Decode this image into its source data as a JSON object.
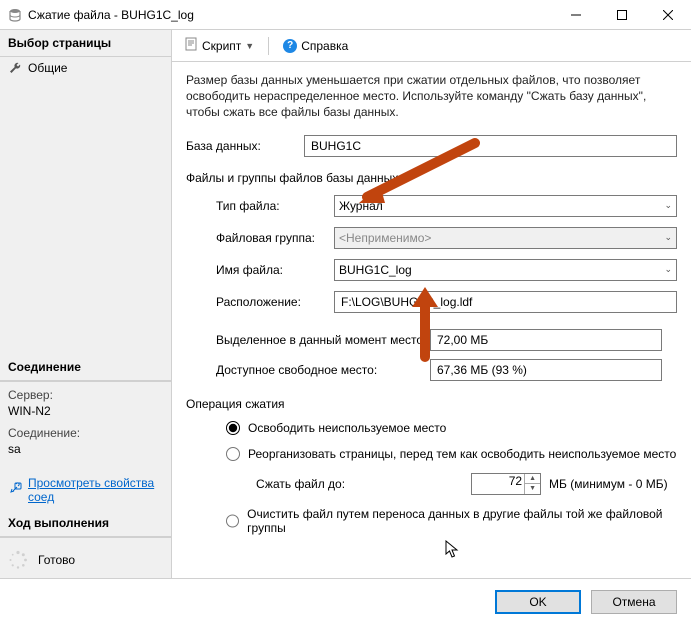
{
  "window": {
    "title": "Сжатие файла - BUHG1C_log"
  },
  "sidebar": {
    "page_select": "Выбор страницы",
    "page_general": "Общие",
    "connection_header": "Соединение",
    "server_label": "Сервер:",
    "server_value": "WIN-N2",
    "conn_label": "Соединение:",
    "conn_value": "sa",
    "view_props": "Просмотреть свойства соед",
    "progress_header": "Ход выполнения",
    "progress_status": "Готово"
  },
  "toolbar": {
    "script": "Скрипт",
    "help": "Справка"
  },
  "content": {
    "description": "Размер базы данных уменьшается при сжатии отдельных файлов, что позволяет освободить нераспределенное место. Используйте команду \"Сжать базу данных\", чтобы сжать все файлы базы данных.",
    "db_label": "База данных:",
    "db_value": "BUHG1C",
    "files_section": "Файлы и группы файлов базы данных",
    "file_type_label": "Тип файла:",
    "file_type_value": "Журнал",
    "filegroup_label": "Файловая группа:",
    "filegroup_value": "<Неприменимо>",
    "filename_label": "Имя файла:",
    "filename_value": "BUHG1C_log",
    "location_label": "Расположение:",
    "location_value": "F:\\LOG\\BUHG1C_log.ldf",
    "allocated_label": "Выделенное в данный момент место:",
    "allocated_value": "72,00 МБ",
    "available_label": "Доступное свободное место:",
    "available_value": "67,36 МБ (93 %)",
    "op_label": "Операция сжатия",
    "op_release": "Освободить неиспользуемое место",
    "op_reorganize": "Реорганизовать страницы, перед тем как освободить неиспользуемое место",
    "shrink_to_label": "Сжать файл до:",
    "shrink_to_value": "72",
    "shrink_to_units": "МБ (минимум - 0 МБ)",
    "op_empty": "Очистить файл путем переноса данных в другие файлы той же файловой группы"
  },
  "footer": {
    "ok": "OK",
    "cancel": "Отмена"
  }
}
